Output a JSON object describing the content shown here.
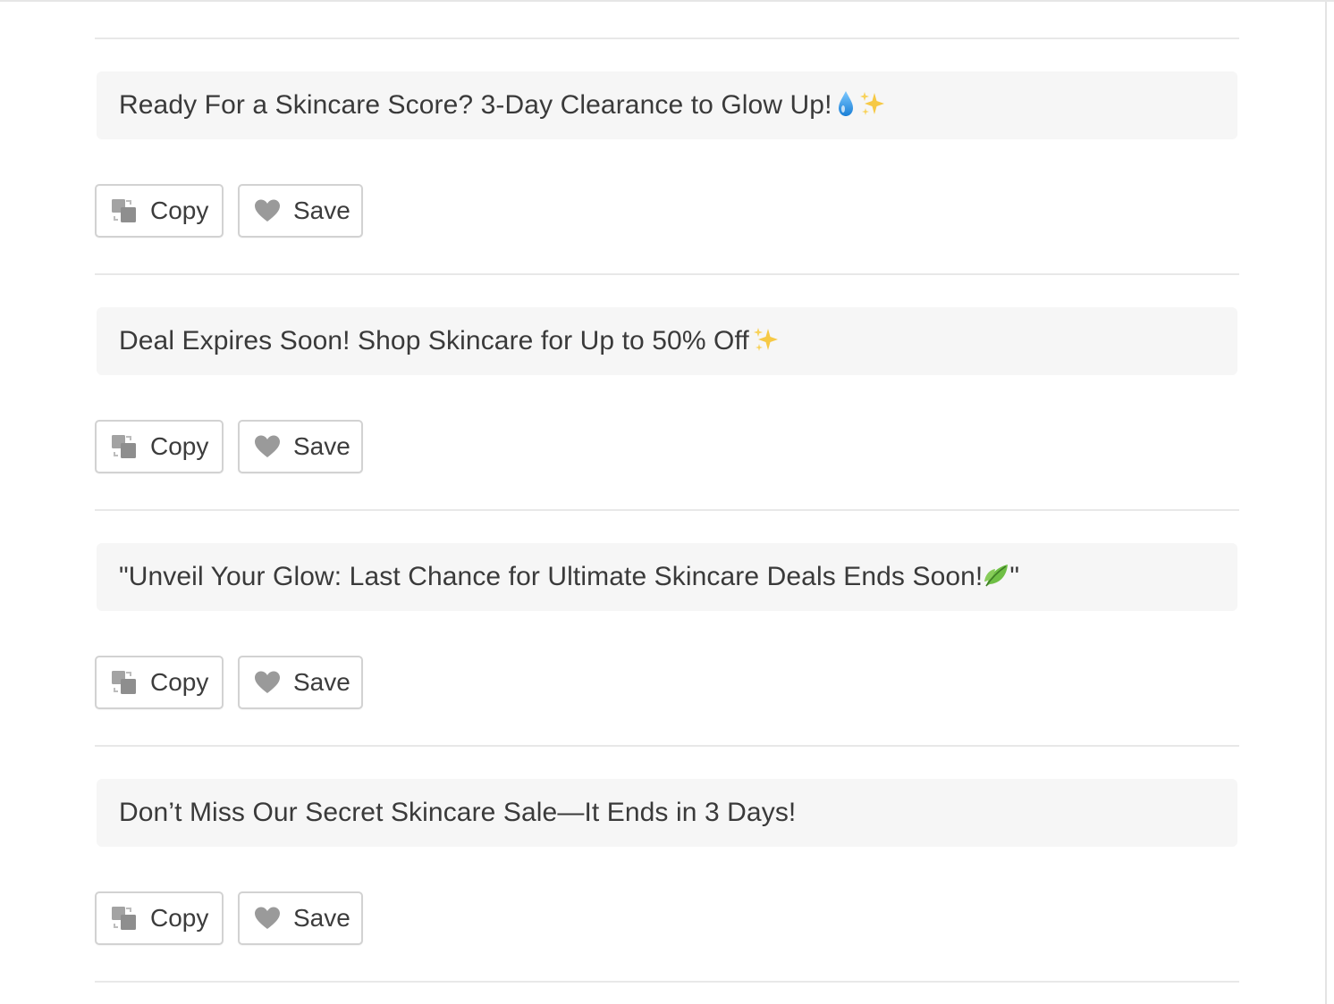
{
  "headlines": [
    {
      "text": "Ready For a Skincare Score? 3-Day Clearance to Glow Up! ",
      "emojis": [
        "droplet-icon",
        "sparkles-icon"
      ]
    },
    {
      "text": "Deal Expires Soon! Shop Skincare for Up to 50% Off ",
      "emojis": [
        "sparkles-icon"
      ]
    },
    {
      "text": "\"Unveil Your Glow: Last Chance for Ultimate Skincare Deals Ends Soon!",
      "emojis": [
        "leaf-icon"
      ],
      "suffix": "\""
    },
    {
      "text": "Don’t Miss Our Secret Skincare Sale—It Ends in 3 Days!",
      "emojis": []
    }
  ],
  "actions": {
    "copy_label": "Copy",
    "save_label": "Save"
  },
  "colors": {
    "headline_bg": "#f6f6f6",
    "button_border": "#d2d2d2",
    "icon_gray": "#9a9a9a",
    "droplet": "#2f9be8",
    "sparkle": "#f6c945",
    "leaf": "#5aa53a"
  }
}
